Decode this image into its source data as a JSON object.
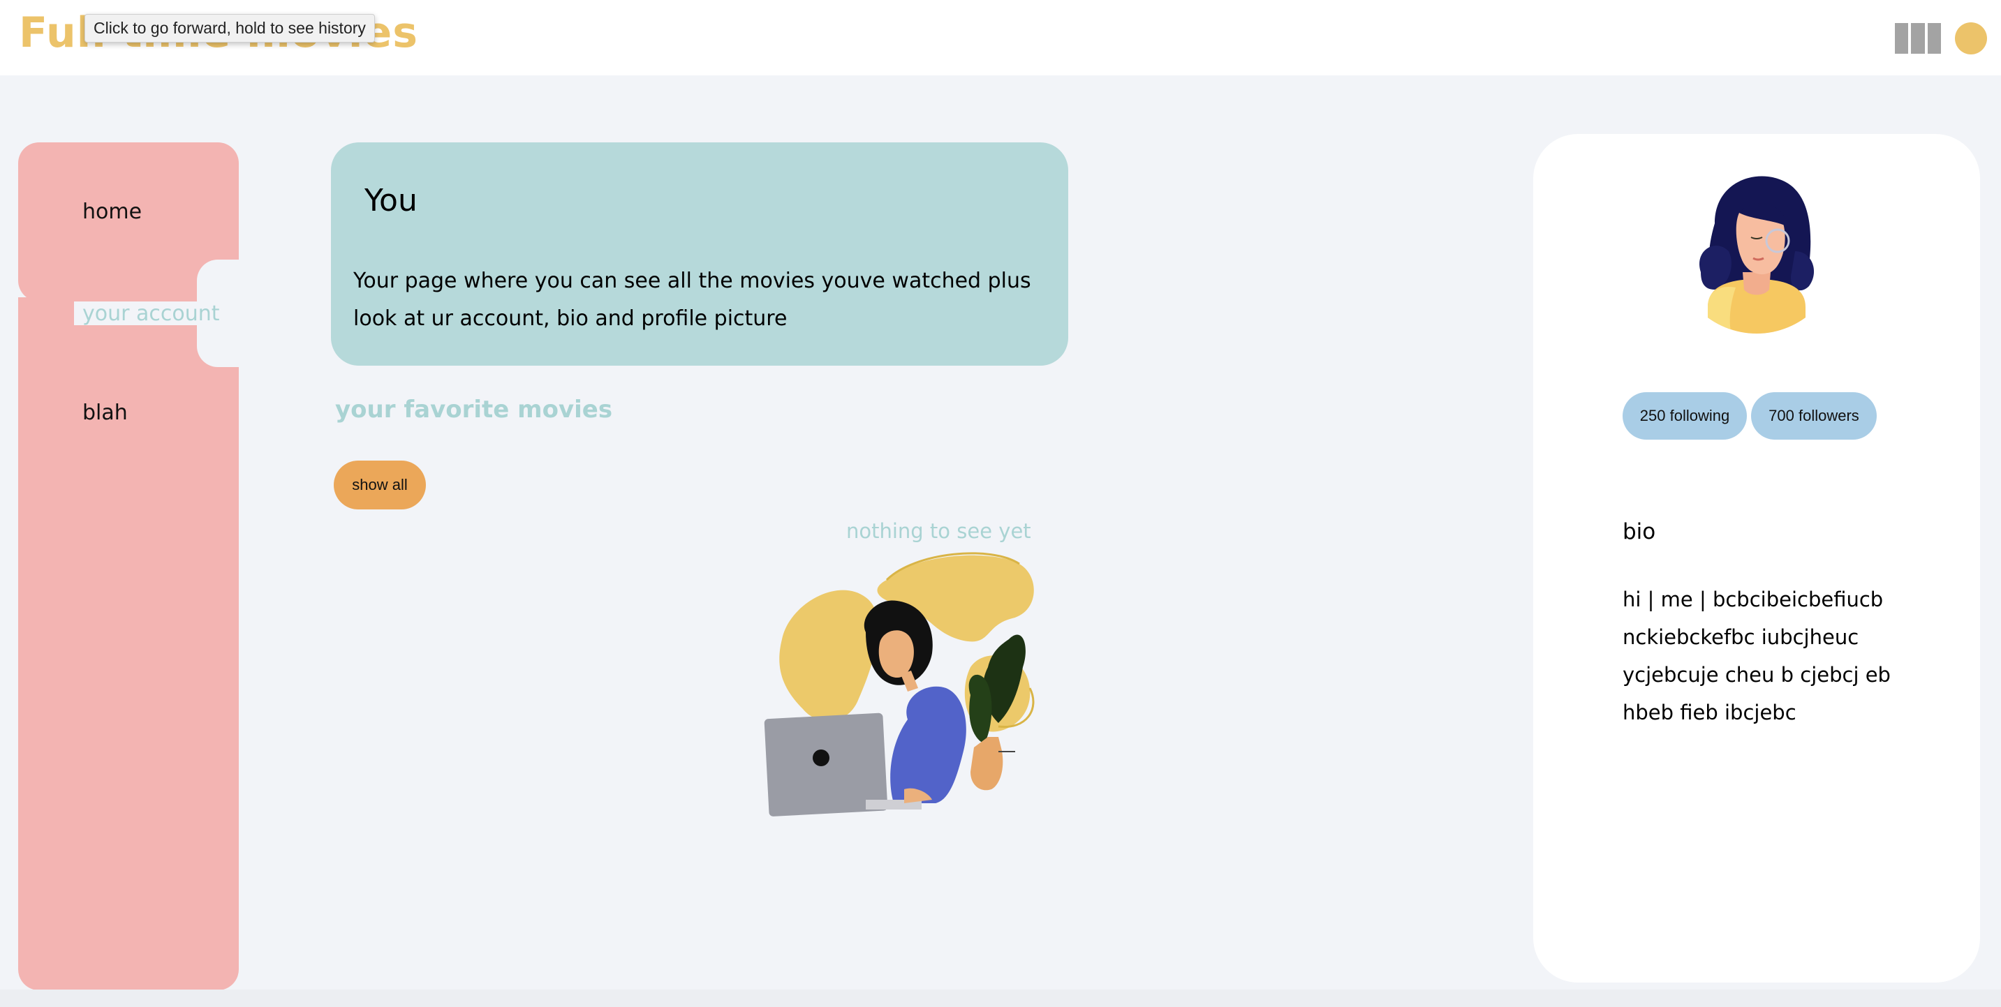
{
  "header": {
    "brand": "Full time movies",
    "tooltip": "Click to go forward, hold to see history"
  },
  "sidebar": {
    "items": [
      {
        "label": "home",
        "active": false
      },
      {
        "label": "your account",
        "active": true
      },
      {
        "label": "blah",
        "active": false
      }
    ]
  },
  "intro": {
    "title": "You",
    "text": "Your page where you can see all the movies youve watched plus look at ur account, bio and profile picture"
  },
  "favorites": {
    "heading": "your favorite movies",
    "show_all_label": "show all",
    "empty_text": "nothing to see yet"
  },
  "profile": {
    "following_label": "250 following",
    "followers_label": "700 followers",
    "bio_label": "bio",
    "bio_text": "hi | me | bcbcibeicbefiucb nckiebckefbc iubcjheuc ycjebcuje cheu b cjebcj eb hbeb fieb ibcjebc"
  },
  "colors": {
    "brand": "#ecc36a",
    "sidebar": "#f3b4b2",
    "intro_card": "#b6d9da",
    "accent_teal": "#a9d3d3",
    "show_all_button": "#eba759",
    "follow_pill": "#a9cde6",
    "background": "#f2f4f8"
  }
}
